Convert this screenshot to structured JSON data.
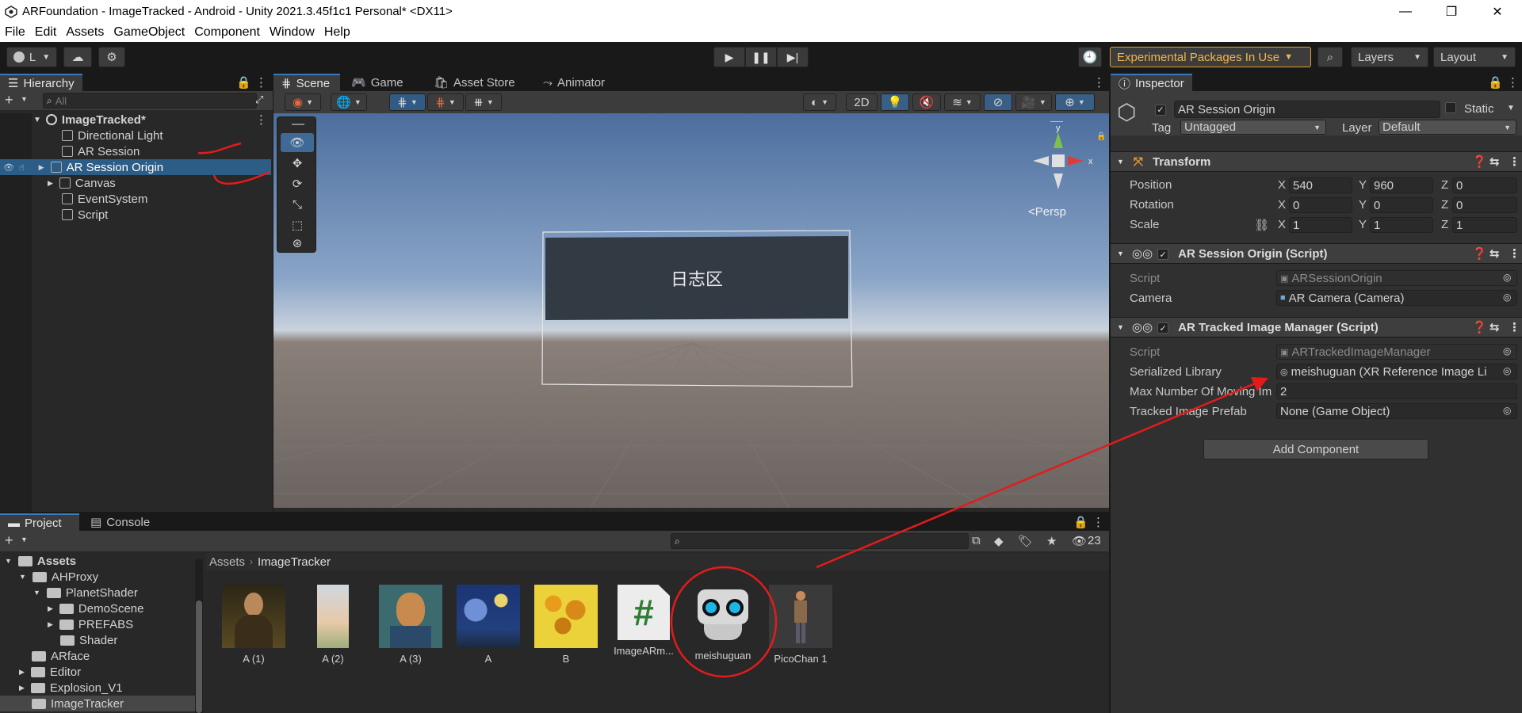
{
  "window": {
    "title": "ARFoundation - ImageTracked - Android - Unity 2021.3.45f1c1 Personal* <DX11>"
  },
  "menu": [
    "File",
    "Edit",
    "Assets",
    "GameObject",
    "Component",
    "Window",
    "Help"
  ],
  "toolbar": {
    "account_label": "L",
    "experimental_label": "Experimental Packages In Use",
    "layers_label": "Layers",
    "layout_label": "Layout"
  },
  "hierarchy": {
    "tab": "Hierarchy",
    "search_placeholder": "All",
    "scene": "ImageTracked*",
    "items": [
      "Directional Light",
      "AR Session",
      "AR Session Origin",
      "Canvas",
      "EventSystem",
      "Script"
    ]
  },
  "scene_tabs": [
    "Scene",
    "Game",
    "Asset Store",
    "Animator"
  ],
  "scene_view": {
    "mode_2d": "2D",
    "persp": "Persp",
    "panel_text": "日志区",
    "gizmo_x": "x",
    "gizmo_y": "y"
  },
  "inspector": {
    "tab": "Inspector",
    "object_name": "AR Session Origin",
    "static_label": "Static",
    "tag_label": "Tag",
    "tag_value": "Untagged",
    "layer_label": "Layer",
    "layer_value": "Default",
    "transform": {
      "title": "Transform",
      "position_label": "Position",
      "rotation_label": "Rotation",
      "scale_label": "Scale",
      "position": [
        "540",
        "960",
        "0"
      ],
      "rotation": [
        "0",
        "0",
        "0"
      ],
      "scale": [
        "1",
        "1",
        "1"
      ],
      "axis": [
        "X",
        "Y",
        "Z"
      ]
    },
    "session_origin": {
      "title": "AR Session Origin (Script)",
      "script_label": "Script",
      "script_value": "ARSessionOrigin",
      "camera_label": "Camera",
      "camera_value": "AR Camera (Camera)"
    },
    "tracked_image_manager": {
      "title": "AR Tracked Image Manager (Script)",
      "script_label": "Script",
      "script_value": "ARTrackedImageManager",
      "serialized_label": "Serialized Library",
      "serialized_value": "meishuguan (XR Reference Image Li",
      "max_label": "Max Number Of Moving Im",
      "max_value": "2",
      "prefab_label": "Tracked Image Prefab",
      "prefab_value": "None (Game Object)"
    },
    "add_component": "Add Component"
  },
  "project": {
    "tabs": [
      "Project",
      "Console"
    ],
    "hidden_count": "23",
    "tree": [
      {
        "label": "Assets",
        "depth": 0,
        "bold": true
      },
      {
        "label": "AHProxy",
        "depth": 1
      },
      {
        "label": "PlanetShader",
        "depth": 2
      },
      {
        "label": "DemoScene",
        "depth": 3
      },
      {
        "label": "PREFABS",
        "depth": 3
      },
      {
        "label": "Shader",
        "depth": 3
      },
      {
        "label": "ARface",
        "depth": 1
      },
      {
        "label": "Editor",
        "depth": 1
      },
      {
        "label": "Explosion_V1",
        "depth": 1
      },
      {
        "label": "ImageTracker",
        "depth": 1
      }
    ],
    "breadcrumb": [
      "Assets",
      "ImageTracker"
    ],
    "assets": [
      "A (1)",
      "A (2)",
      "A (3)",
      "A",
      "B",
      "ImageARm...",
      "meishuguan",
      "PicoChan 1"
    ]
  }
}
